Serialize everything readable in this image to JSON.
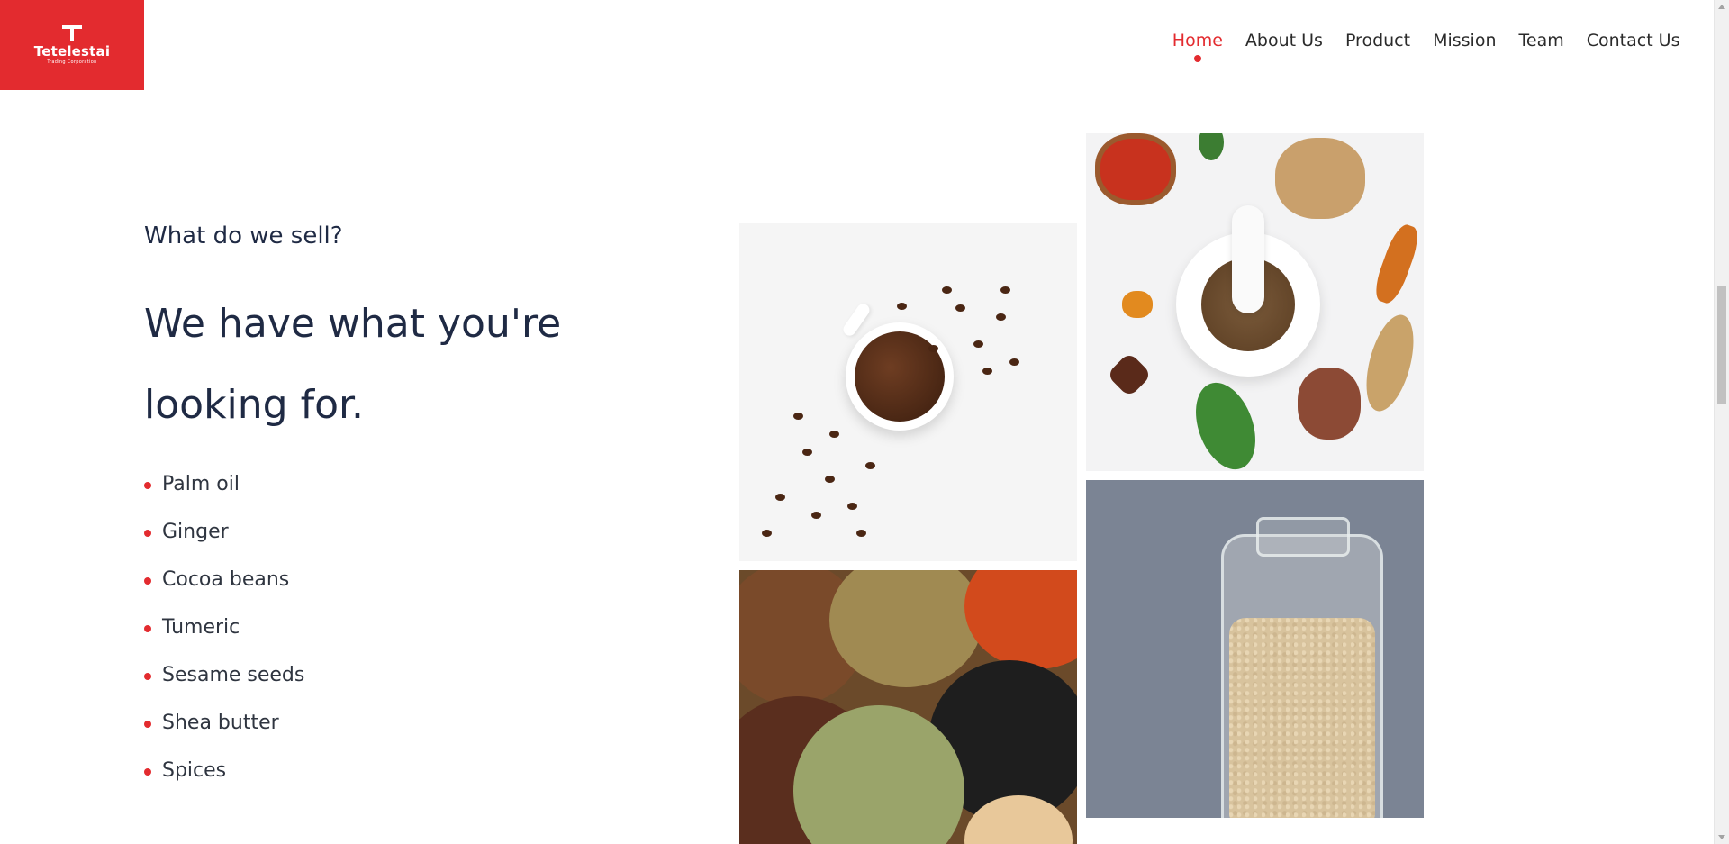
{
  "header": {
    "logo": {
      "name": "Tetelestai",
      "tagline": "Trading Corporation"
    },
    "nav": [
      {
        "label": "Home",
        "active": true
      },
      {
        "label": "About Us",
        "active": false
      },
      {
        "label": "Product",
        "active": false
      },
      {
        "label": "Mission",
        "active": false
      },
      {
        "label": "Team",
        "active": false
      },
      {
        "label": "Contact Us",
        "active": false
      }
    ]
  },
  "section": {
    "eyebrow": "What do we sell?",
    "headline": "We have what you're looking for.",
    "products": [
      "Palm oil",
      "Ginger",
      "Cocoa beans",
      "Tumeric",
      "Sesame seeds",
      "Shea butter",
      "Spices"
    ]
  },
  "images": {
    "coffee": "coffee-beans-cup-image",
    "spices_board": "mortar-and-spices-image",
    "mixed_spices": "mixed-spices-image",
    "sesame_jar": "sesame-seeds-jar-image"
  },
  "colors": {
    "accent": "#e32b2f",
    "heading": "#1f2a44",
    "text": "#2f3540"
  }
}
